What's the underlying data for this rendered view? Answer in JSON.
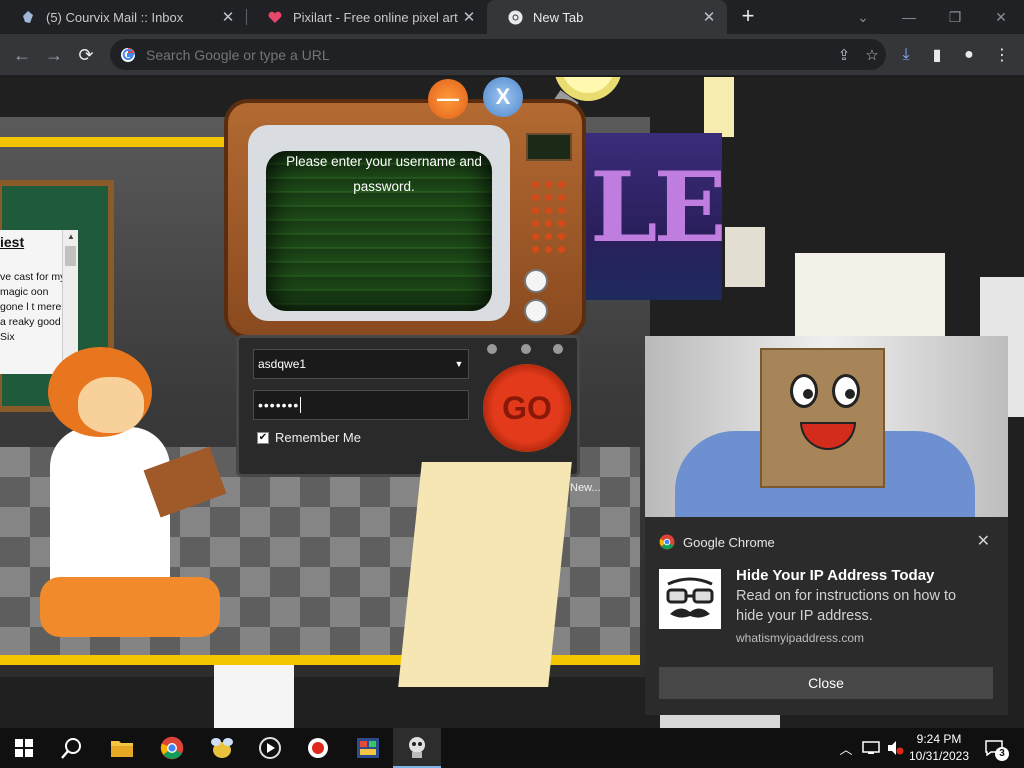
{
  "browser": {
    "tabs": [
      {
        "title": "(5) Courvix Mail :: Inbox",
        "icon": "courvix-favicon"
      },
      {
        "title": "Pixilart - Free online pixel art dra",
        "icon": "pixilart-heart-favicon"
      },
      {
        "title": "New Tab",
        "icon": "chrome-favicon",
        "active": true
      }
    ],
    "omnibox_placeholder": "Search Google or type a URL"
  },
  "game": {
    "tv_message": "Please enter your username and password.",
    "username": "asdqwe1",
    "password_masked": "•••••••",
    "remember_label": "Remember Me",
    "remember_checked": true,
    "go_label": "GO",
    "minimize_label": "—",
    "close_label": "X",
    "side_heading": "iest",
    "side_text": "ve cast for my magic oon gone l t merely a reaky good Six",
    "ble_text": "LE",
    "new_hint": "New..."
  },
  "notification": {
    "app": "Google Chrome",
    "title": "Hide Your IP Address Today",
    "body": "Read on for instructions on how to hide your IP address.",
    "source": "whatismyipaddress.com",
    "button": "Close"
  },
  "taskbar": {
    "time": "9:24 PM",
    "date": "10/31/2023",
    "notification_count": "3"
  },
  "colors": {
    "chrome_dark": "#202124",
    "toolbar": "#35363a",
    "shelf_yellow": "#f3c400",
    "go_red": "#e23a1a",
    "taskbar": "#101010"
  }
}
